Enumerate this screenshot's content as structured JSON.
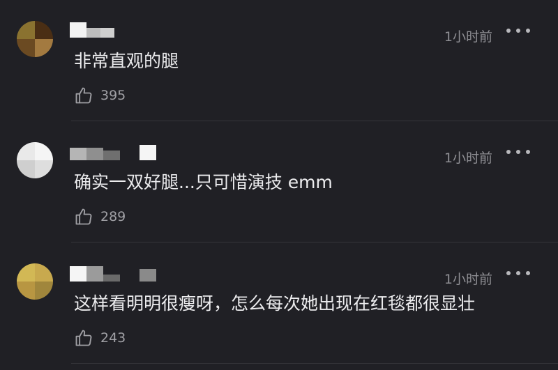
{
  "comments": [
    {
      "text": "非常直观的腿",
      "time": "1小时前",
      "likes": "395",
      "avatar_colors": [
        "#8a7230",
        "#4a2e14",
        "#6b4a22",
        "#a37a40"
      ],
      "username_colors": [
        "#f2f2f2",
        "#e9e9e9",
        "#bdbdbd",
        "#cfcfcf"
      ]
    },
    {
      "text": "确实一双好腿...只可惜演技 emm",
      "time": "1小时前",
      "likes": "289",
      "avatar_colors": [
        "#e9e9e9",
        "#f5f5f5",
        "#cfcfcf",
        "#dedede"
      ],
      "username_colors": [
        "#b5b5b5",
        "#8f8f8f",
        "#d0d0d0",
        "#f5f5f5"
      ]
    },
    {
      "text": "这样看明明很瘦呀，怎么每次她出现在红毯都很显壮",
      "time": "1小时前",
      "likes": "243",
      "avatar_colors": [
        "#d2b855",
        "#c8a94e",
        "#b89642",
        "#a0863c"
      ],
      "username_colors": [
        "#f5f5f5",
        "#9b9b9b",
        "#cccccc",
        "#8a8a8a"
      ]
    }
  ],
  "icons": {
    "like": "thumbs-up-icon",
    "more": "more-dots-icon"
  }
}
